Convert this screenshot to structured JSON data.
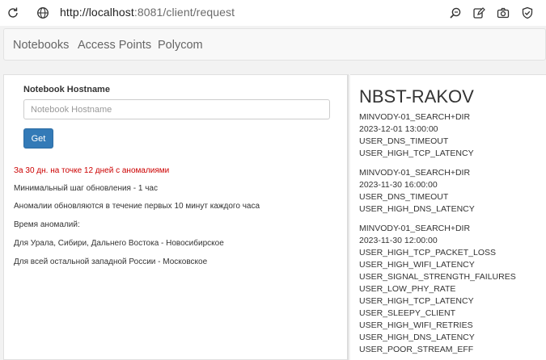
{
  "browser": {
    "url_host": "http://localhost",
    "url_rest": ":8081/client/request",
    "icons": [
      "refresh-icon",
      "globe-icon",
      "zoom-icon",
      "edit-icon",
      "camera-icon",
      "shield-icon"
    ]
  },
  "navbar": {
    "items": [
      {
        "label": "Notebooks"
      },
      {
        "label": "Access Points"
      },
      {
        "label": "Polycom"
      }
    ]
  },
  "form": {
    "label": "Notebook Hostname",
    "placeholder": "Notebook Hostname",
    "value": "",
    "get_label": "Get"
  },
  "info": {
    "alert": "За 30 дн. на точке 12 дней с аномалиями",
    "lines": [
      "Минимальный шаг обновления - 1 час",
      "Аномалии обновляются в течение первых 10 минут каждого часа",
      "Время аномалий:",
      "Для Урала, Сибири, Дальнего Востока - Новосибирское",
      "Для всей остальной западной России - Московское"
    ]
  },
  "result": {
    "hostname": "NBST-RAKOV",
    "groups": [
      {
        "ap": "MINVODY-01_SEARCH+DIR",
        "time": "2023-12-01 13:00:00",
        "anomalies": [
          "USER_DNS_TIMEOUT",
          "USER_HIGH_TCP_LATENCY"
        ]
      },
      {
        "ap": "MINVODY-01_SEARCH+DIR",
        "time": "2023-11-30 16:00:00",
        "anomalies": [
          "USER_DNS_TIMEOUT",
          "USER_HIGH_DNS_LATENCY"
        ]
      },
      {
        "ap": "MINVODY-01_SEARCH+DIR",
        "time": "2023-11-30 12:00:00",
        "anomalies": [
          "USER_HIGH_TCP_PACKET_LOSS",
          "USER_HIGH_WIFI_LATENCY",
          "USER_SIGNAL_STRENGTH_FAILURES",
          "USER_LOW_PHY_RATE",
          "USER_HIGH_TCP_LATENCY",
          "USER_SLEEPY_CLIENT",
          "USER_HIGH_WIFI_RETRIES",
          "USER_HIGH_DNS_LATENCY",
          "USER_POOR_STREAM_EFF"
        ]
      }
    ]
  }
}
